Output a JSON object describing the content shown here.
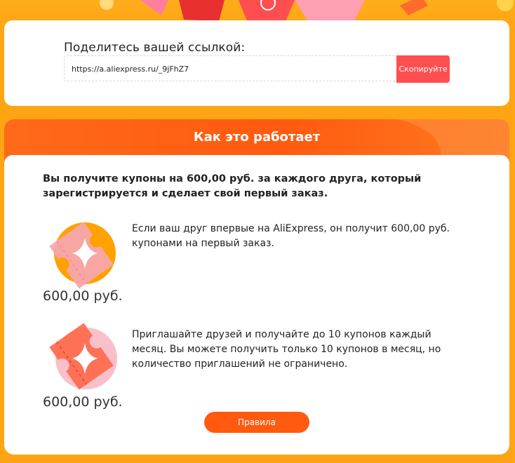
{
  "share": {
    "title": "Поделитесь вашей ссылкой:",
    "link": "https://a.aliexpress.ru/_9jFhZ7",
    "copy_label": "Скопируйте"
  },
  "how": {
    "header": "Как это работает",
    "lead": "Вы получите купоны на 600,00 руб. за каждого друга, который зарегистрируется и сделает свой первый заказ.",
    "steps": [
      {
        "amount": "600,00 руб.",
        "text": "Если ваш друг впервые на AliExpress, он получит 600,00 руб. купонами на первый заказ.",
        "icon": "coupon-ticket-icon"
      },
      {
        "amount": "600,00 руб.",
        "text": "Приглашайте друзей и получайте до 10 купонов каждый месяц. Вы можете получить только 10 купонов в месяц, но количество приглашений не ограничено.",
        "icon": "coupon-ticket-icon"
      }
    ],
    "rules_label": "Правила"
  },
  "colors": {
    "page_bg": "#ffa514",
    "header_orange": "#ff5a10",
    "copy_red": "#ff4e50",
    "icon_pink": "#f6a6b2",
    "icon_red": "#ff6a4d",
    "icon_yellow": "#ffa200"
  }
}
